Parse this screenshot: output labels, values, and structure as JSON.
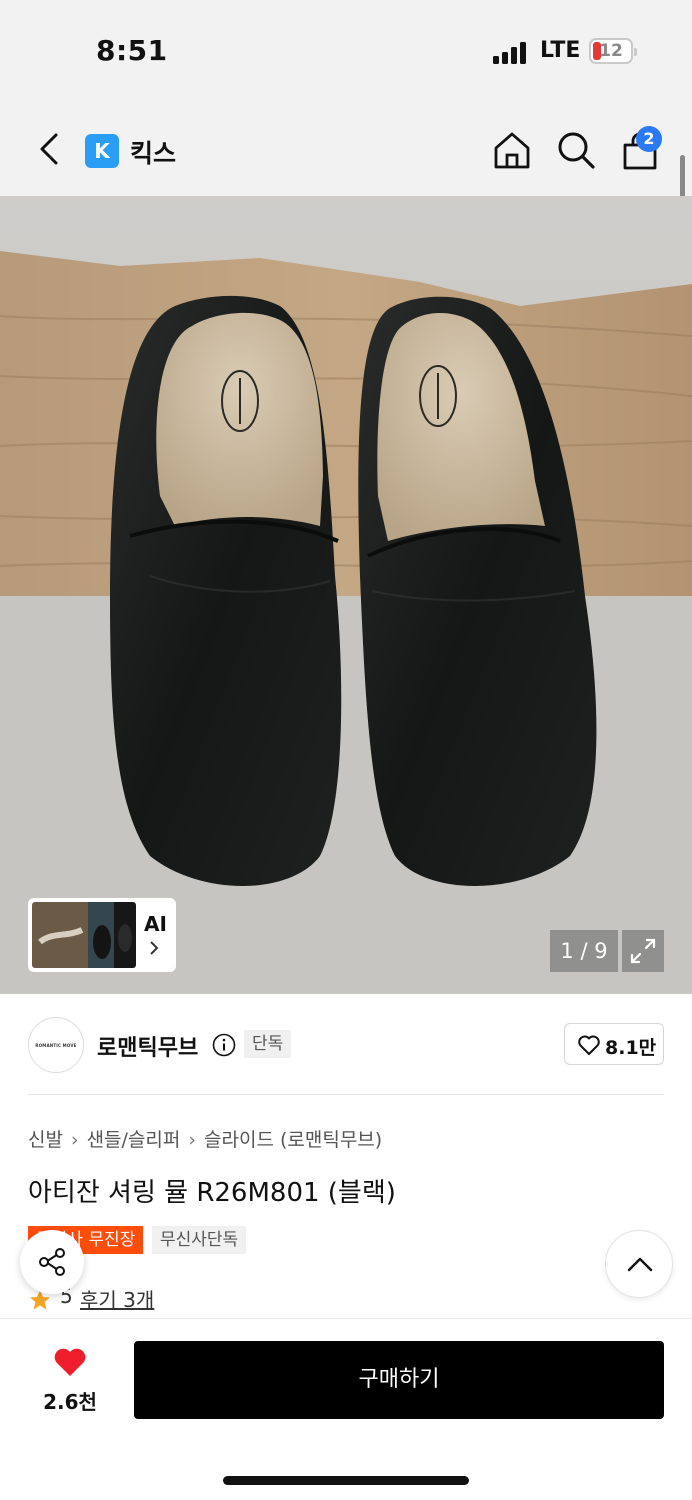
{
  "status_bar": {
    "time": "8:51",
    "network": "LTE",
    "battery_level": "12",
    "battery_color": "#e53935"
  },
  "nav": {
    "app_logo_letter": "K",
    "app_name": "킥스",
    "cart_badge_count": "2",
    "icons": [
      "back-icon",
      "home-icon",
      "search-icon",
      "shopping-bag-icon"
    ],
    "accent_color": "#2a9df4"
  },
  "product_image": {
    "ai_label": "AI",
    "page_counter": "1 / 9"
  },
  "brand": {
    "avatar_text": "ROMANTIC MOVE",
    "name": "로맨틱무브",
    "exclusive_badge": "단독",
    "like_count": "8.1만"
  },
  "product": {
    "breadcrumb": [
      "신발",
      "샌들/슬리퍼",
      "슬라이드 (로맨틱무브)"
    ],
    "title": "아티잔 셔링 뮬 R26M801 (블랙)",
    "badges": [
      "무신사 무진장",
      "무신사단독"
    ],
    "badge_color": "#ff4d0c",
    "rating": "5",
    "review_link": "후기 3개"
  },
  "bottom_bar": {
    "wish_count": "2.6천",
    "buy_label": "구매하기"
  }
}
